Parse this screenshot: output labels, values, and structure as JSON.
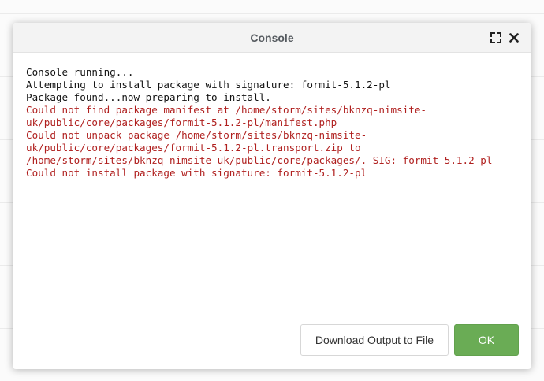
{
  "dialog": {
    "title": "Console",
    "maximize_icon": "maximize-icon",
    "close_icon": "close-icon"
  },
  "console": {
    "lines": [
      {
        "text": "Console running...",
        "type": "info"
      },
      {
        "text": "Attempting to install package with signature: formit-5.1.2-pl",
        "type": "info"
      },
      {
        "text": "Package found...now preparing to install.",
        "type": "info"
      },
      {
        "text": "Could not find package manifest at /home/storm/sites/bknzq-nimsite-",
        "type": "error"
      },
      {
        "text": "uk/public/core/packages/formit-5.1.2-pl/manifest.php",
        "type": "error"
      },
      {
        "text": "Could not unpack package /home/storm/sites/bknzq-nimsite-",
        "type": "error"
      },
      {
        "text": "uk/public/core/packages/formit-5.1.2-pl.transport.zip to",
        "type": "error"
      },
      {
        "text": "/home/storm/sites/bknzq-nimsite-uk/public/core/packages/. SIG: formit-5.1.2-pl",
        "type": "error"
      },
      {
        "text": "Could not install package with signature: formit-5.1.2-pl",
        "type": "error"
      }
    ],
    "colors": {
      "info": "#111111",
      "error": "#b0201f"
    }
  },
  "footer": {
    "download_label": "Download Output to File",
    "ok_label": "OK",
    "ok_color": "#6aac55"
  }
}
